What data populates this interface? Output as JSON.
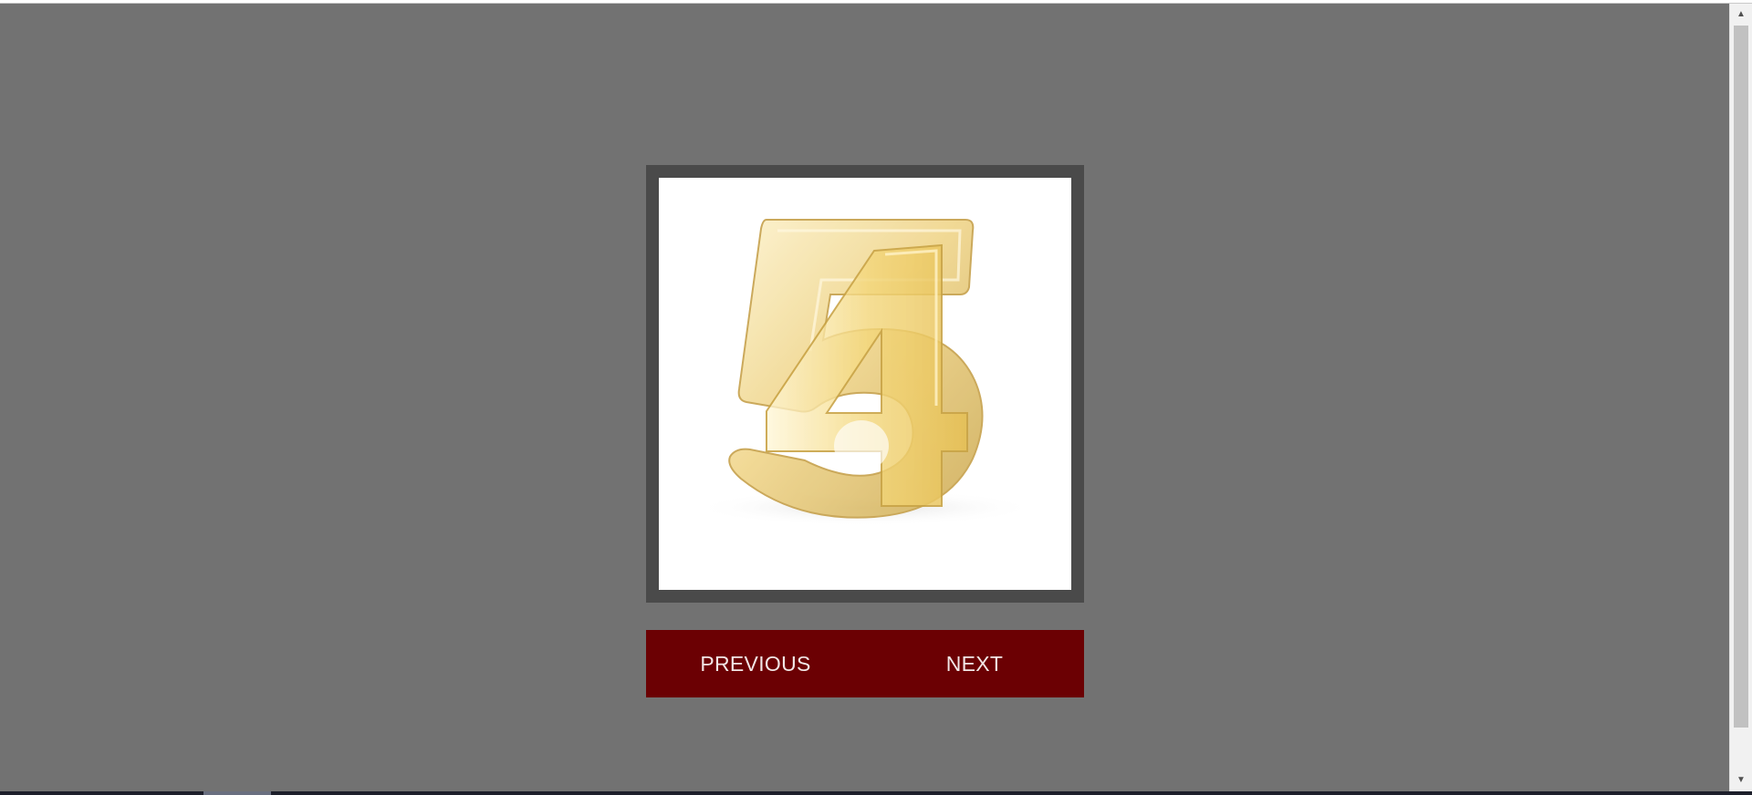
{
  "slideshow": {
    "current_slide": {
      "icon": "gold-number-5-and-4-icon",
      "depicted_numbers": [
        "5",
        "4"
      ]
    },
    "previous_label": "PREVIOUS",
    "next_label": "NEXT"
  },
  "colors": {
    "page_background": "#727272",
    "frame_border": "#4a4a4a",
    "slide_background": "#ffffff",
    "nav_background": "#6b0003",
    "nav_text": "#f1e6e6",
    "gold_light": "#fbeec0",
    "gold_mid": "#ecd07c",
    "gold_dark": "#c9a446"
  },
  "scrollbar": {
    "up_icon": "scroll-up-arrow-icon",
    "down_icon": "scroll-down-arrow-icon"
  }
}
